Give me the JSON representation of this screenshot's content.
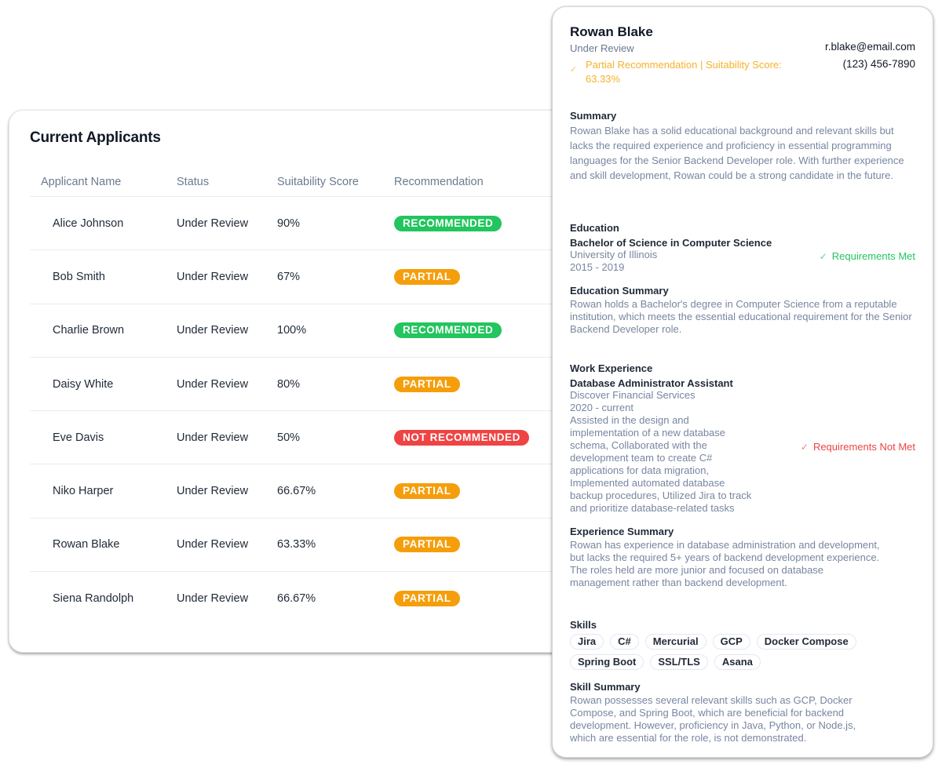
{
  "colors": {
    "recommended": "#22c55e",
    "partial": "#f59e0b",
    "not_recommended": "#ef4444",
    "partial_text": "#f5b22a",
    "met": "#22c55e",
    "not_met": "#ef4444"
  },
  "applicants": {
    "title": "Current Applicants",
    "columns": [
      "Applicant Name",
      "Status",
      "Suitability Score",
      "Recommendation"
    ],
    "rows": [
      {
        "name": "Alice Johnson",
        "status": "Under Review",
        "score": "90%",
        "recommendation": "RECOMMENDED",
        "level": "recommended"
      },
      {
        "name": "Bob Smith",
        "status": "Under Review",
        "score": "67%",
        "recommendation": "PARTIAL",
        "level": "partial"
      },
      {
        "name": "Charlie Brown",
        "status": "Under Review",
        "score": "100%",
        "recommendation": "RECOMMENDED",
        "level": "recommended"
      },
      {
        "name": "Daisy White",
        "status": "Under Review",
        "score": "80%",
        "recommendation": "PARTIAL",
        "level": "partial"
      },
      {
        "name": "Eve Davis",
        "status": "Under Review",
        "score": "50%",
        "recommendation": "NOT RECOMMENDED",
        "level": "not_recommended"
      },
      {
        "name": "Niko Harper",
        "status": "Under Review",
        "score": "66.67%",
        "recommendation": "PARTIAL",
        "level": "partial"
      },
      {
        "name": "Rowan Blake",
        "status": "Under Review",
        "score": "63.33%",
        "recommendation": "PARTIAL",
        "level": "partial"
      },
      {
        "name": "Siena Randolph",
        "status": "Under Review",
        "score": "66.67%",
        "recommendation": "PARTIAL",
        "level": "partial"
      }
    ]
  },
  "detail": {
    "name": "Rowan Blake",
    "status": "Under Review",
    "recommendation_line": "Partial Recommendation | Suitability Score: 63.33%",
    "email": "r.blake@email.com",
    "phone": "(123) 456-7890",
    "summary": {
      "title": "Summary",
      "text": "Rowan Blake has a solid educational background and relevant skills but lacks the required experience and proficiency in essential programming languages for the Senior Backend Developer role. With further experience and skill development, Rowan could be a strong candidate in the future."
    },
    "education": {
      "title": "Education",
      "degree": "Bachelor of Science in Computer Science",
      "school": "University of Illinois",
      "years": "2015 - 2019",
      "requirement": "Requirements Met",
      "summary_title": "Education Summary",
      "summary": "Rowan holds a Bachelor's degree in Computer Science from a reputable institution, which meets the essential educational requirement for the Senior Backend Developer role."
    },
    "work": {
      "title": "Work Experience",
      "role": "Database Administrator Assistant",
      "company": "Discover Financial Services",
      "years": "2020 - current",
      "description": "Assisted in the design and implementation of a new database schema, Collaborated with the development team to create C# applications for data migration, Implemented automated database backup procedures, Utilized Jira to track and prioritize database-related tasks",
      "requirement": "Requirements Not Met",
      "summary_title": "Experience Summary",
      "summary": "Rowan has experience in database administration and development, but lacks the required 5+ years of backend development experience. The roles held are more junior and focused on database management rather than backend development."
    },
    "skills": {
      "title": "Skills",
      "items": [
        "Jira",
        "C#",
        "Mercurial",
        "GCP",
        "Docker Compose",
        "Spring Boot",
        "SSL/TLS",
        "Asana"
      ],
      "summary_title": "Skill Summary",
      "summary": "Rowan possesses several relevant skills such as GCP, Docker Compose, and Spring Boot, which are beneficial for backend development. However, proficiency in Java, Python, or Node.js, which are essential for the role, is not demonstrated."
    }
  }
}
